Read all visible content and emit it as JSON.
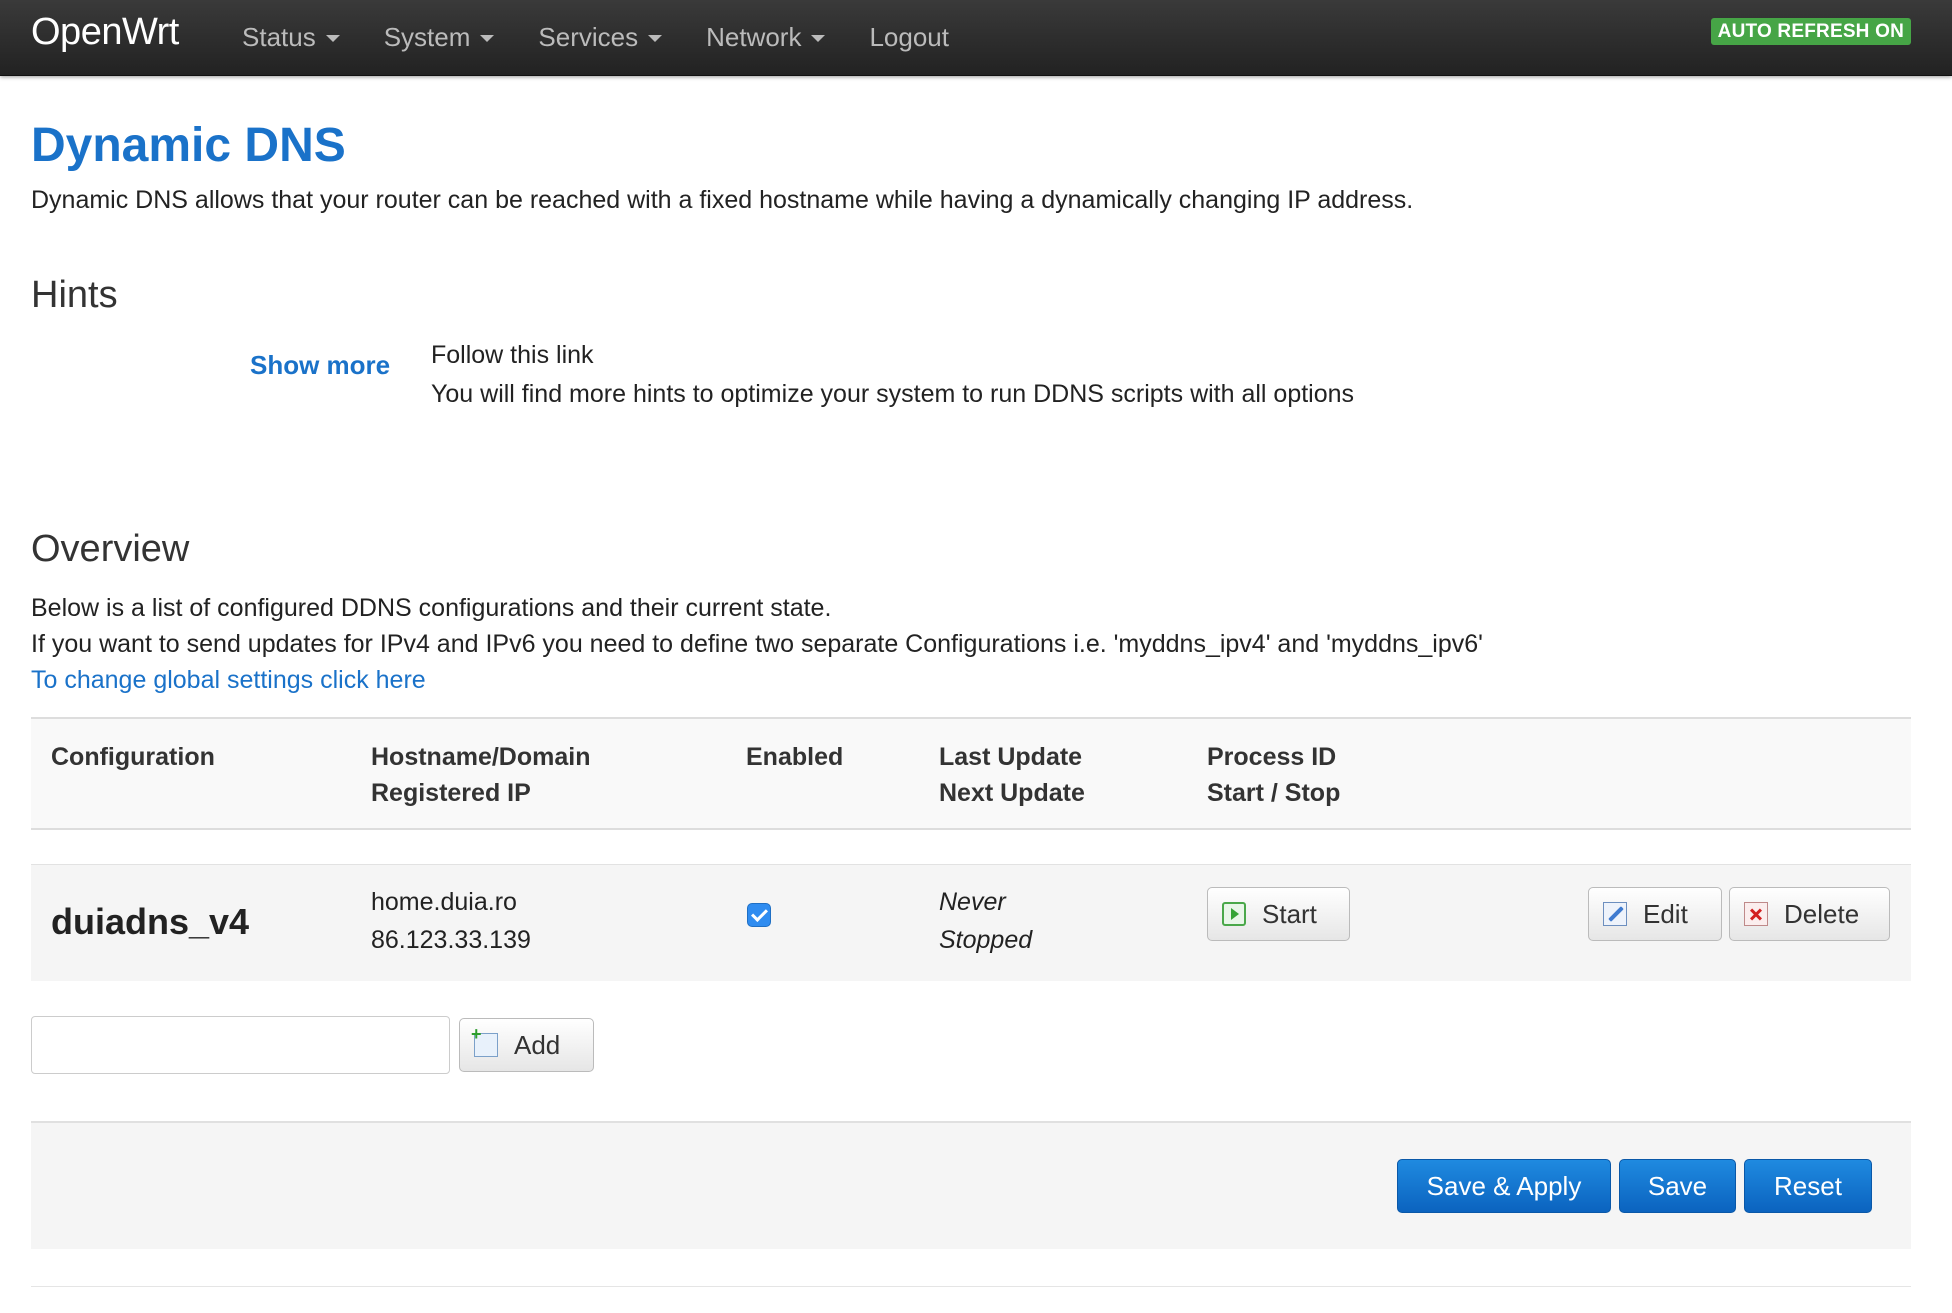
{
  "navbar": {
    "brand": "OpenWrt",
    "menu": [
      {
        "label": "Status",
        "dropdown": true
      },
      {
        "label": "System",
        "dropdown": true
      },
      {
        "label": "Services",
        "dropdown": true
      },
      {
        "label": "Network",
        "dropdown": true
      },
      {
        "label": "Logout",
        "dropdown": false
      }
    ],
    "auto_refresh": "AUTO REFRESH ON",
    "auto_refresh_color": "#46a546"
  },
  "page": {
    "title": "Dynamic DNS",
    "title_color": "#1a72c9",
    "description": "Dynamic DNS allows that your router can be reached with a fixed hostname while having a dynamically changing IP address."
  },
  "hints": {
    "heading": "Hints",
    "show_more": "Show more",
    "line1": "Follow this link",
    "line2": "You will find more hints to optimize your system to run DDNS scripts with all options"
  },
  "overview": {
    "heading": "Overview",
    "line1": "Below is a list of configured DDNS configurations and their current state.",
    "line2": "If you want to send updates for IPv4 and IPv6 you need to define two separate Configurations i.e. 'myddns_ipv4' and 'myddns_ipv6'",
    "link": "To change global settings click here"
  },
  "table": {
    "headers": {
      "configuration": "Configuration",
      "hostname": "Hostname/Domain",
      "registered_ip": "Registered IP",
      "enabled": "Enabled",
      "last_update": "Last Update",
      "next_update": "Next Update",
      "process_id": "Process ID",
      "start_stop": "Start / Stop"
    },
    "rows": [
      {
        "name": "duiadns_v4",
        "hostname": "home.duia.ro",
        "ip": "86.123.33.139",
        "enabled": true,
        "last_update": "Never",
        "next_update": "Stopped",
        "start_label": "Start",
        "edit_label": "Edit",
        "delete_label": "Delete"
      }
    ]
  },
  "add": {
    "input_value": "",
    "button_label": "Add"
  },
  "actions": {
    "save_apply": "Save & Apply",
    "save": "Save",
    "reset": "Reset",
    "primary_color": "#1a72c9"
  }
}
